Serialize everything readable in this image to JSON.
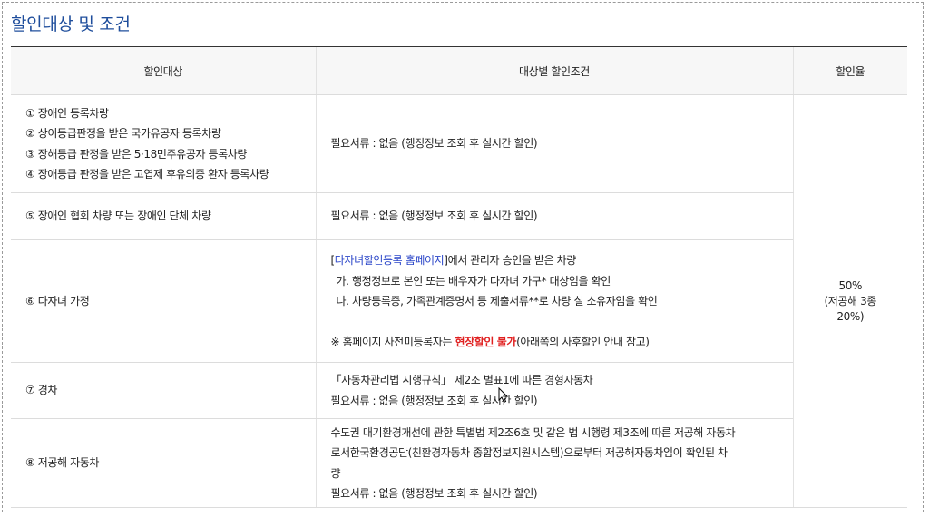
{
  "title": "할인대상 및 조건",
  "headers": {
    "target": "할인대상",
    "condition": "대상별 할인조건",
    "rate": "할인율"
  },
  "rate": {
    "line1": "50%",
    "line2": "(저공해 3종",
    "line3": "20%)"
  },
  "rows": [
    {
      "targets": [
        "① 장애인 등록차량",
        "② 상이등급판정을 받은 국가유공자 등록차량",
        "③ 장해등급 판정을 받은 5·18민주유공자 등록차량",
        "④ 장애등급 판정을 받은 고엽제 후유의증 환자 등록차량"
      ],
      "condition": "필요서류 : 없음 (행정정보 조회 후 실시간 할인)"
    },
    {
      "target": "⑤ 장애인 협회 차량 또는 장애인 단체 차량",
      "condition": "필요서류 : 없음 (행정정보 조회 후 실시간 할인)"
    },
    {
      "target": "⑥ 다자녀 가정",
      "link_open": "[",
      "link_text": "다자녀할인등록 홈페이지",
      "link_close": "]",
      "link_suffix": "에서 관리자 승인을 받은 차량",
      "sub1": "가. 행정정보로 본인 또는 배우자가 다자녀 가구* 대상임을 확인",
      "sub2": "나. 차량등록증, 가족관계증명서 등 제출서류**로 차량 실 소유자임을 확인",
      "note_prefix": "※ 홈페이지 사전미등록자는 ",
      "note_highlight": "현장할인 불가",
      "note_suffix": "(아래쪽의 사후할인 안내 참고)"
    },
    {
      "target": "⑦ 경차",
      "line1": "「자동차관리법 시행규칙」 제2조 별표1에 따른 경형자동차",
      "condition": "필요서류 : 없음 (행정정보 조회 후 실시간 할인)"
    },
    {
      "target": "⑧ 저공해 자동차",
      "line1": "수도권 대기환경개선에 관한 특별법 제2조6호 및 같은 법 시행령 제3조에 따른 저공해 자동차",
      "line2": "로서한국환경공단(친환경자동차 종합정보지원시스템)으로부터 저공해자동차임이 확인된 차",
      "line3": "량",
      "condition": "필요서류 : 없음 (행정정보 조회 후 실시간 할인)"
    }
  ]
}
